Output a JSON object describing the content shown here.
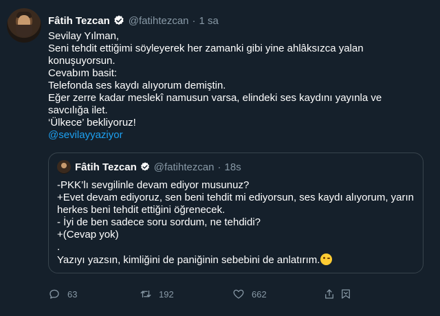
{
  "tweet": {
    "author": {
      "name": "Fâtih Tezcan",
      "handle": "@fatihtezcan"
    },
    "separator": "·",
    "time": "1 sa",
    "lines": [
      "Sevilay Yılman,",
      "Seni tehdit ettiğimi söyleyerek her zamanki gibi yine ahlâksızca yalan konuşuyorsun.",
      "Cevabım basit:",
      "Telefonda ses kaydı alıyorum demiştin.",
      "Eğer zerre kadar meslekî namusun varsa, elindeki ses kaydını yayınla ve savcılığa ilet.",
      "‘Ülkece’ bekliyoruz!"
    ],
    "mention": "@sevilayyaziyor"
  },
  "quoted_tweet": {
    "author": {
      "name": "Fâtih Tezcan",
      "handle": "@fatihtezcan"
    },
    "separator": "·",
    "time": "18s",
    "lines": [
      "-PKK’lı sevgilinle devam ediyor musunuz?",
      "+Evet devam ediyoruz, sen beni tehdit mi ediyorsun, ses kaydı alıyorum, yarın herkes beni tehdit ettiğini öğrenecek.",
      "- İyi de ben sadece soru sordum, ne tehdidi?",
      "+(Cevap yok)",
      "."
    ],
    "last_line": "Yazıyı yazsın, kimliğini de paniğinin sebebini de anlatırım.",
    "emoji": "winking-face"
  },
  "actions": {
    "replies": "63",
    "retweets": "192",
    "likes": "662"
  },
  "colors": {
    "background": "#15202b",
    "text": "#ffffff",
    "secondary": "#8899a6",
    "link": "#1da1f2",
    "border": "#38444d",
    "verified": "#ffffff"
  },
  "icons": [
    "verified-badge-icon",
    "reply-icon",
    "retweet-icon",
    "like-icon",
    "share-icon",
    "bookmark-icon"
  ]
}
